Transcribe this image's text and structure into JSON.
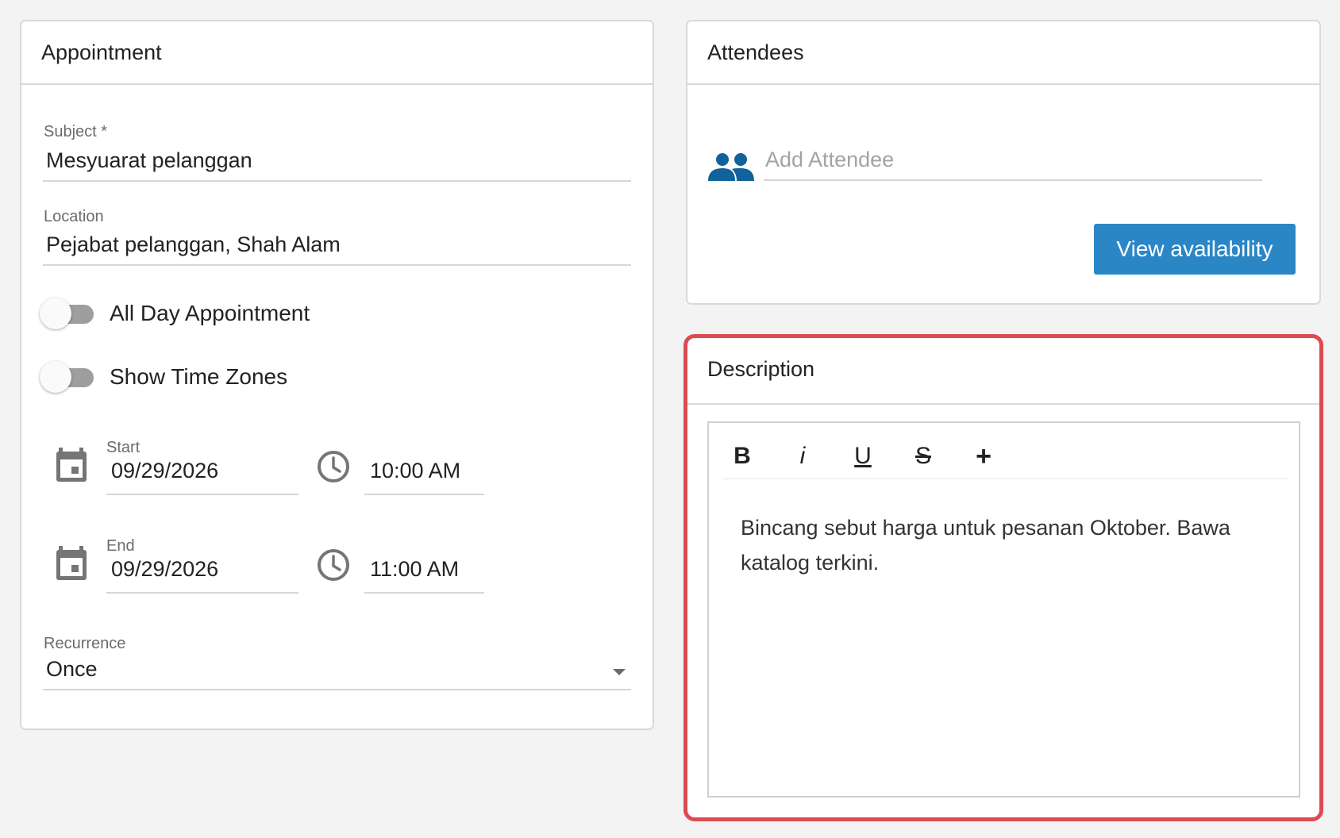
{
  "appointment": {
    "header": "Appointment",
    "subject": {
      "label": "Subject *",
      "value": "Mesyuarat pelanggan"
    },
    "location": {
      "label": "Location",
      "value": "Pejabat pelanggan, Shah Alam"
    },
    "all_day": {
      "label": "All Day Appointment",
      "checked": false
    },
    "time_zones": {
      "label": "Show Time Zones",
      "checked": false
    },
    "start": {
      "label": "Start",
      "date": "09/29/2026",
      "time": "10:00 AM"
    },
    "end": {
      "label": "End",
      "date": "09/29/2026",
      "time": "11:00 AM"
    },
    "recurrence": {
      "label": "Recurrence",
      "value": "Once"
    }
  },
  "attendees": {
    "header": "Attendees",
    "placeholder": "Add Attendee",
    "view_button": "View availability"
  },
  "description": {
    "header": "Description",
    "toolbar": {
      "bold": "B",
      "italic": "i",
      "underline": "U",
      "strike": "S",
      "more": "+"
    },
    "content": "Bincang sebut harga untuk pesanan Oktober. Bawa katalog terkini."
  },
  "colors": {
    "accent": "#2b86c6",
    "icon_blue": "#10629a",
    "highlight_border": "#dc4a52",
    "toggle_off": "#9e9e9e"
  }
}
